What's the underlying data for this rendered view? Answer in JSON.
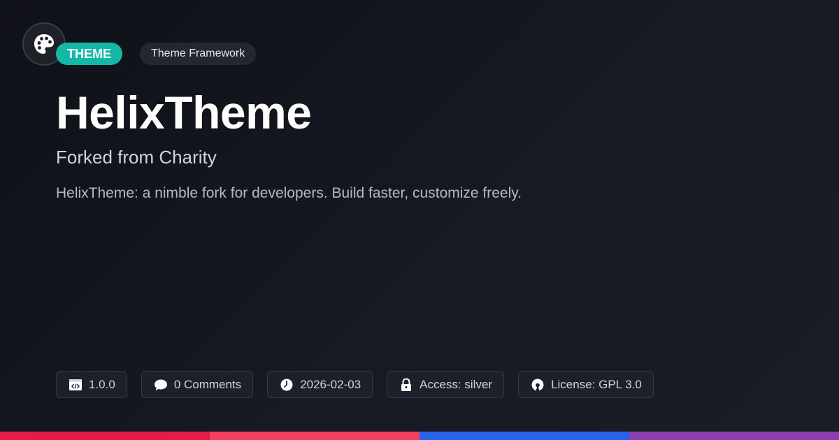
{
  "logo": {
    "icon": "palette-icon"
  },
  "badges": {
    "type_label": "THEME",
    "category_label": "Theme Framework"
  },
  "title": "HelixTheme",
  "subtitle": "Forked from Charity",
  "description": "HelixTheme: a nimble fork for developers. Build faster, customize freely.",
  "meta": [
    {
      "icon": "code-icon",
      "label": "1.0.0"
    },
    {
      "icon": "comment-icon",
      "label": "0 Comments"
    },
    {
      "icon": "clock-icon",
      "label": "2026-02-03"
    },
    {
      "icon": "lock-icon",
      "label": "Access: silver"
    },
    {
      "icon": "open-source-icon",
      "label": "License: GPL 3.0"
    }
  ],
  "colors": {
    "accent": "#14b8a6",
    "bar": [
      "#e11d48",
      "#f43f5e",
      "#2563eb",
      "#8b3fb0"
    ]
  }
}
